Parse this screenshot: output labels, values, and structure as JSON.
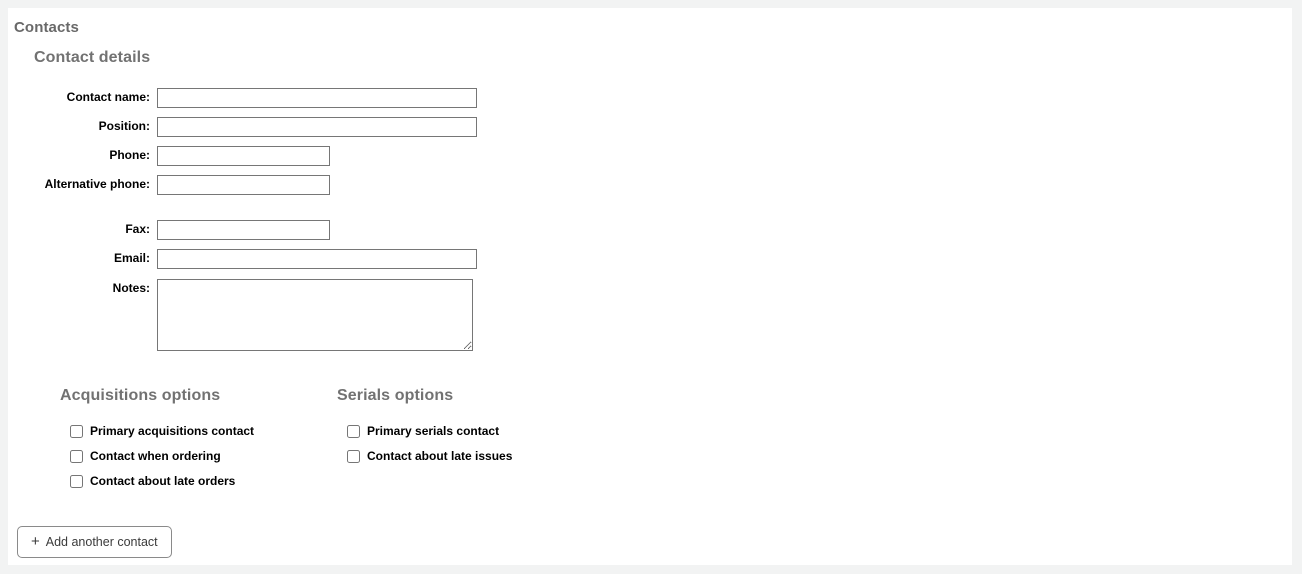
{
  "page": {
    "panel_bg": "#ffffff",
    "page_bg": "#f2f3f3",
    "heading_color": "#727272"
  },
  "headings": {
    "contacts": "Contacts",
    "contact_details": "Contact details"
  },
  "form": {
    "fields": [
      {
        "label": "Contact name:",
        "value": "",
        "placeholder": "",
        "size": "wide",
        "name": "contact-name"
      },
      {
        "label": "Position:",
        "value": "",
        "placeholder": "",
        "size": "wide",
        "name": "position"
      },
      {
        "label": "Phone:",
        "value": "",
        "placeholder": "",
        "size": "short",
        "name": "phone"
      },
      {
        "label": "Alternative phone:",
        "value": "",
        "placeholder": "",
        "size": "short",
        "name": "alternative-phone"
      },
      {
        "label": "Fax:",
        "value": "",
        "placeholder": "",
        "size": "short",
        "name": "fax"
      },
      {
        "label": "Email:",
        "value": "",
        "placeholder": "",
        "size": "wide",
        "name": "email"
      }
    ],
    "notes": {
      "label": "Notes:",
      "value": "",
      "placeholder": ""
    }
  },
  "acquisitions_options": {
    "heading": "Acquisitions options",
    "items": [
      {
        "label": "Primary acquisitions contact",
        "checked": false,
        "name": "primary-acquisitions-contact"
      },
      {
        "label": "Contact when ordering",
        "checked": false,
        "name": "contact-when-ordering"
      },
      {
        "label": "Contact about late orders",
        "checked": false,
        "name": "contact-about-late-orders"
      }
    ]
  },
  "serials_options": {
    "heading": "Serials options",
    "items": [
      {
        "label": "Primary serials contact",
        "checked": false,
        "name": "primary-serials-contact"
      },
      {
        "label": "Contact about late issues",
        "checked": false,
        "name": "contact-about-late-issues"
      }
    ]
  },
  "actions": {
    "add_contact": {
      "icon": "plus-icon",
      "glyph": "+",
      "label": "Add another contact"
    }
  }
}
